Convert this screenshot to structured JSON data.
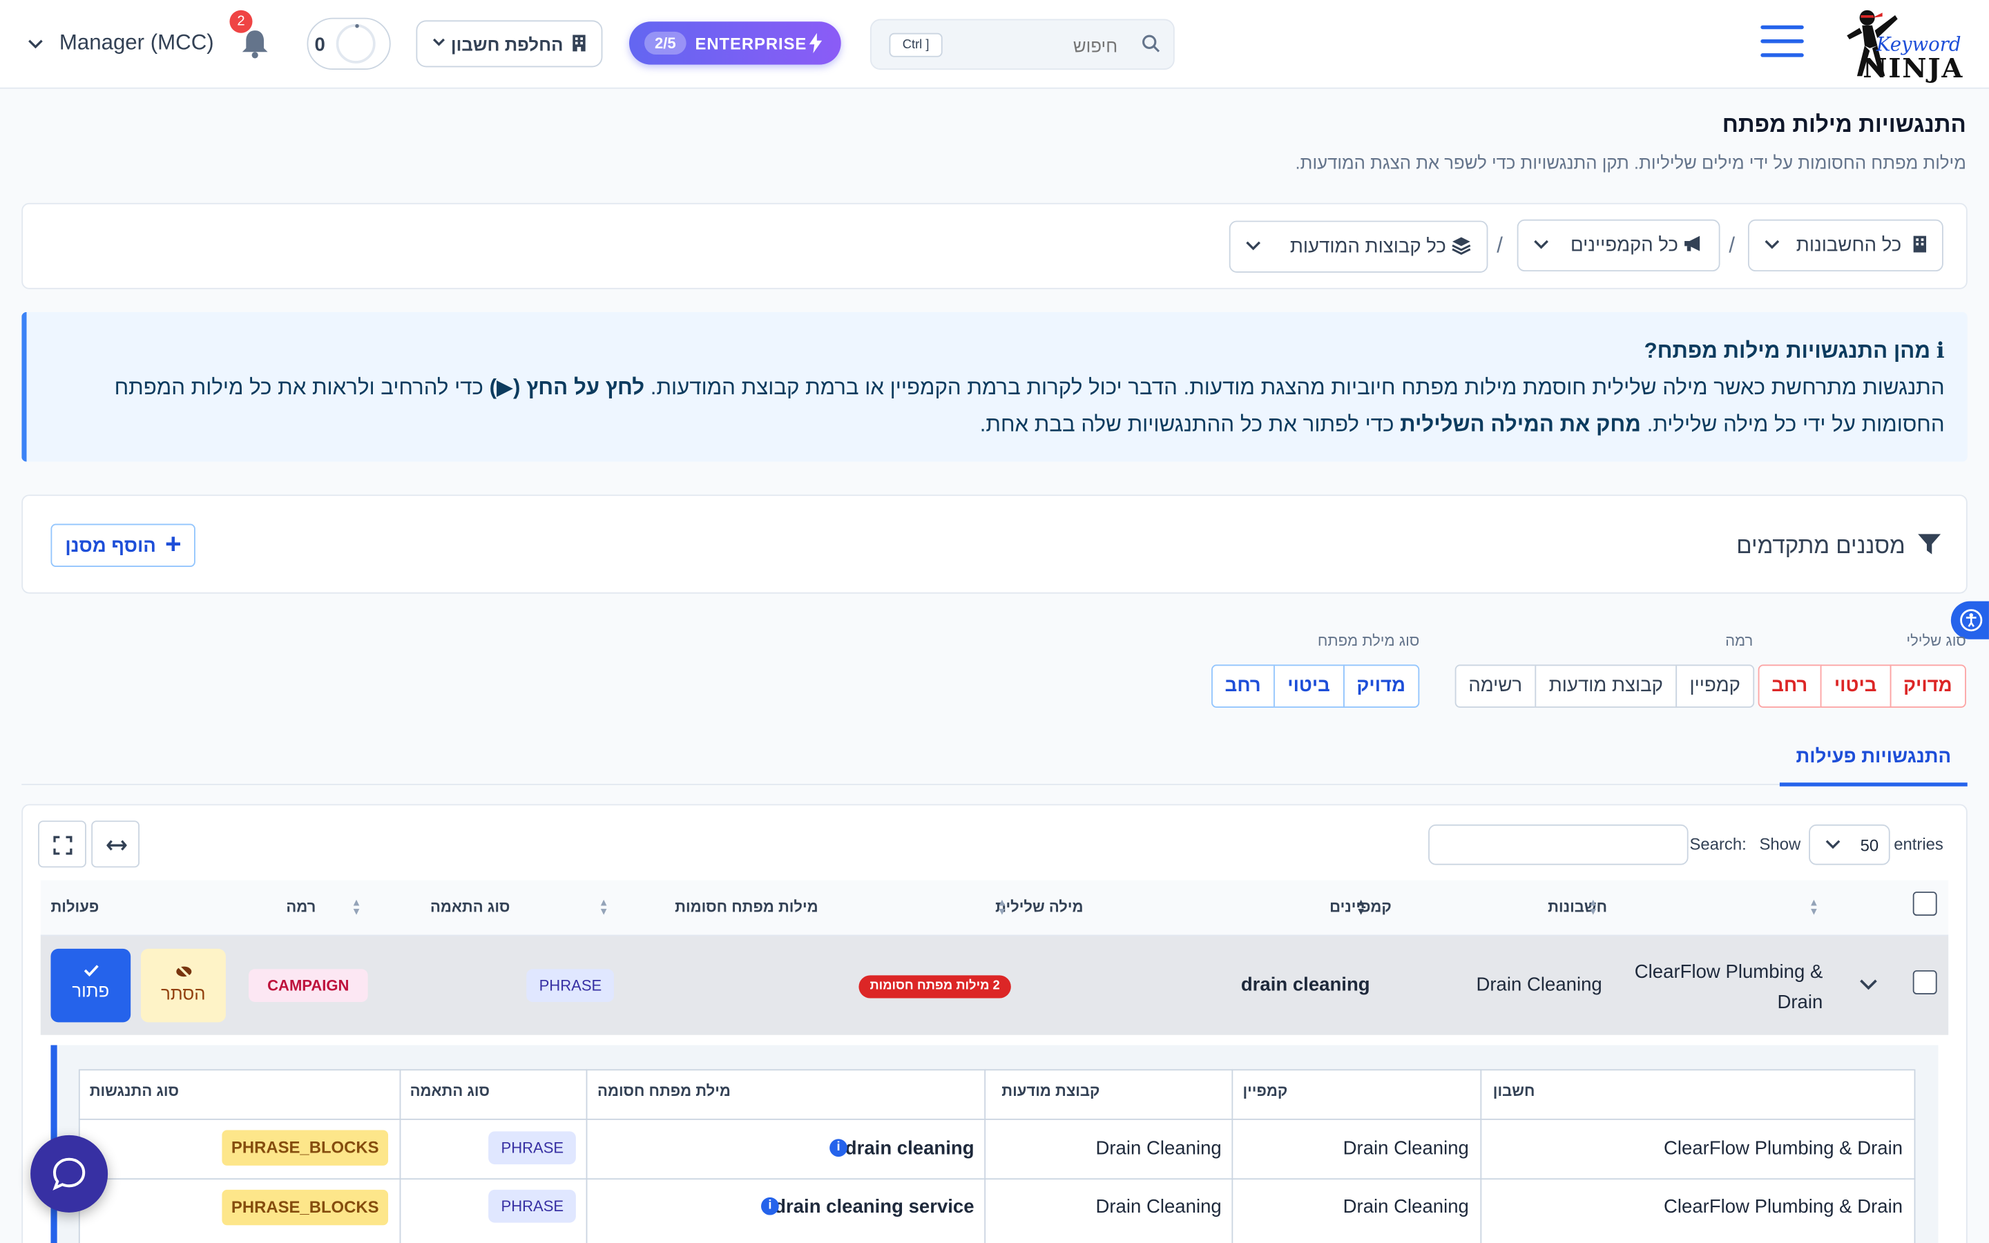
{
  "header": {
    "logo_text_top": "Keyword",
    "logo_text_bottom": "NINJA",
    "search_placeholder": "חיפוש",
    "search_shortcut": "Ctrl ]",
    "plan_count": "2/5",
    "plan_label": "ENTERPRISE",
    "account_switch_label": "החלפת חשבון",
    "counter_value": "0",
    "notification_count": "2",
    "user_label": "Manager (MCC)"
  },
  "page": {
    "title": "התנגשויות מילות מפתח",
    "subtitle": "מילות מפתח החסומות על ידי מילים שליליות. תקן התנגשויות כדי לשפר את הצגת המודעות."
  },
  "filters": {
    "accounts": "כל החשבונות",
    "campaigns": "כל הקמפיינים",
    "adgroups": "כל קבוצות המודעות",
    "separator": "/"
  },
  "info": {
    "title": "מהן התנגשויות מילות מפתח?",
    "text_1": "התנגשות מתרחשת כאשר מילה שלילית חוסמת מילות מפתח חיוביות מהצגת מודעות. הדבר יכול לקרות ברמת הקמפיין או ברמת קבוצת המודעות.",
    "bold_1": "לחץ על החץ (▶)",
    "text_2": "כדי להרחיב ולראות את כל מילות המפתח החסומות על ידי כל מילה שלילית.",
    "bold_2": "מחק את המילה השלילית",
    "text_3": "כדי לפתור את כל ההתנגשויות שלה בבת אחת."
  },
  "advanced": {
    "title": "מסננים מתקדמים",
    "add_filter": "הוסף מסנן"
  },
  "toggles": {
    "negative_type_label": "סוג שלילי",
    "negative_type": [
      "מדויק",
      "ביטוי",
      "רחב"
    ],
    "level_label": "רמה",
    "level": [
      "קמפיין",
      "קבוצת מודעות",
      "רשימה "
    ],
    "keyword_type_label": "סוג מילת מפתח",
    "keyword_type": [
      "מדויק",
      "ביטוי",
      "רחב"
    ]
  },
  "tabs": {
    "active": "התנגשויות פעילות"
  },
  "datatable": {
    "entries_label": "entries",
    "entries_value": "50",
    "show_label": "Show",
    "search_label": "Search:",
    "columns": [
      "חשבונות",
      "קמפיינים",
      "מילה שלילית",
      "מילות מפתח חסומות",
      "סוג התאמה",
      "רמה",
      "פעולות"
    ],
    "row": {
      "account": "ClearFlow Plumbing & Drain",
      "campaign": "Drain Cleaning",
      "negative": "drain cleaning",
      "blocked_badge": "2 מילות מפתח חסומות",
      "match_type": "PHRASE",
      "level": "CAMPAIGN ",
      "hide_label": "הסתר",
      "solve_label": "פתור"
    }
  },
  "nested": {
    "columns": [
      "חשבון",
      "קמפיין",
      "קבוצת מודעות",
      "מילת מפתח חסומה",
      "סוג התאמה",
      "סוג התנגשות"
    ],
    "rows": [
      {
        "account": "ClearFlow Plumbing & Drain",
        "campaign": "Drain Cleaning",
        "adgroup": "Drain Cleaning",
        "keyword": "drain cleaning",
        "match": "PHRASE",
        "conflict": "PHRASE_BLOCKS"
      },
      {
        "account": "ClearFlow Plumbing & Drain",
        "campaign": "Drain Cleaning",
        "adgroup": "Drain Cleaning",
        "keyword": "drain cleaning service",
        "match": "PHRASE",
        "conflict": "PHRASE_BLOCKS"
      }
    ]
  },
  "colors": {
    "accent": "#2563eb",
    "danger": "#dc2626",
    "warning_bg": "#fde68a"
  }
}
